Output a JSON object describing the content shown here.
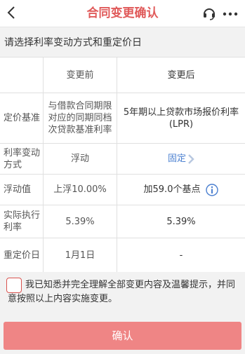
{
  "header": {
    "title": "合同变更确认",
    "back_icon": "chevron-left-icon",
    "service_icon": "headset-icon",
    "more_icon": "more-dots-icon",
    "accent_color": "#e05a5a"
  },
  "subtitle": "请选择利率变动方式和重定价日",
  "table": {
    "headers": {
      "field": "",
      "before": "变更前",
      "after": "变更后"
    },
    "rows": [
      {
        "field": "定价基准",
        "before": "与借款合同期限对应的同期同档次贷款基准利率",
        "after": "5年期以上贷款市场报价利率(LPR)"
      },
      {
        "field": "利率变动方式",
        "before": "浮动",
        "after": "固定"
      },
      {
        "field": "浮动值",
        "before": "上浮10.00%",
        "after": "加59.0个基点"
      },
      {
        "field": "实际执行利率",
        "before": "5.39%",
        "after": "5.39%"
      },
      {
        "field": "重定价日",
        "before": "1月1日",
        "after": "-"
      }
    ]
  },
  "agreement": {
    "checked": false,
    "text": "我已知悉并完全理解全部变更内容及温馨提示，并同意按照以上内容实施变更。"
  },
  "confirm_button": {
    "label": "确认",
    "color": "#ef8585"
  }
}
